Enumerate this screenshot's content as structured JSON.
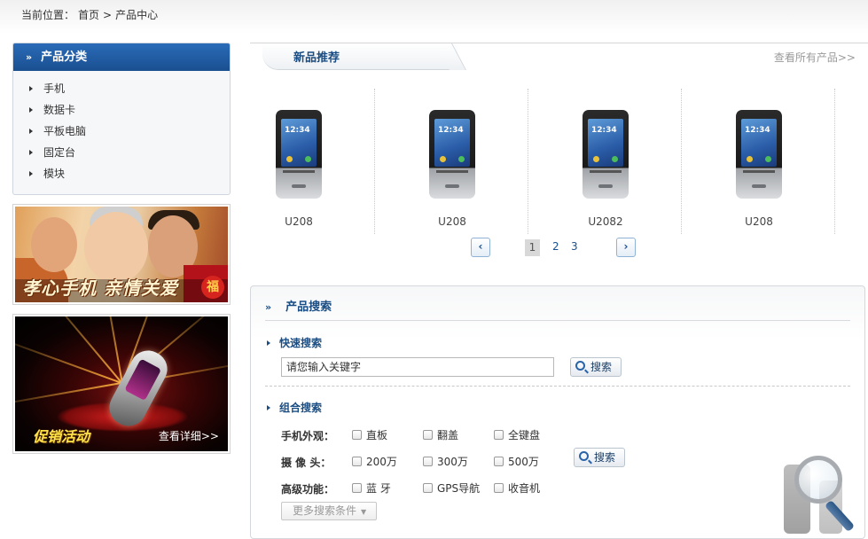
{
  "breadcrumb": {
    "label": "当前位置：",
    "home": "首页",
    "sep": ">",
    "current": "产品中心"
  },
  "sidebar": {
    "title": "产品分类",
    "items": [
      {
        "label": "手机"
      },
      {
        "label": "数据卡"
      },
      {
        "label": "平板电脑"
      },
      {
        "label": "固定台"
      },
      {
        "label": "模块"
      }
    ]
  },
  "ads": {
    "banner1_text": "孝心手机  亲情关爱",
    "banner2_text": "促销活动",
    "banner2_more": "查看详细>>"
  },
  "new_products": {
    "title": "新品推荐",
    "view_all": "查看所有产品>>",
    "items": [
      {
        "name": "U208",
        "clock": "12:34"
      },
      {
        "name": "U208",
        "clock": "12:34"
      },
      {
        "name": "U2082",
        "clock": "12:34"
      },
      {
        "name": "U208",
        "clock": "12:34"
      }
    ],
    "pager": {
      "prev": "‹",
      "next": "›",
      "pages": [
        "1",
        "2",
        "3"
      ],
      "current": 1
    }
  },
  "product_search": {
    "title": "产品搜索",
    "quick": {
      "title": "快速搜索",
      "placeholder": "请您输入关键字",
      "button": "搜索"
    },
    "combined": {
      "title": "组合搜索",
      "button": "搜索",
      "rows": [
        {
          "label": "手机外观：",
          "options": [
            "直板",
            "翻盖",
            "全键盘"
          ]
        },
        {
          "label": "摄 像 头：",
          "options": [
            "200万",
            "300万",
            "500万"
          ]
        },
        {
          "label": "高级功能：",
          "options": [
            "蓝 牙",
            "GPS导航",
            "收音机"
          ]
        }
      ],
      "more_conditions": "更多搜索条件"
    }
  },
  "colors": {
    "brand_blue": "#1a4f90",
    "title_blue": "#1a4d84",
    "link_gray": "#9a9a9a"
  },
  "icons": {
    "double_chevron": "double-chevron-right-icon",
    "triangle": "triangle-right-icon",
    "magnifier": "magnifier-icon",
    "chevron_down": "chevron-down-icon"
  }
}
